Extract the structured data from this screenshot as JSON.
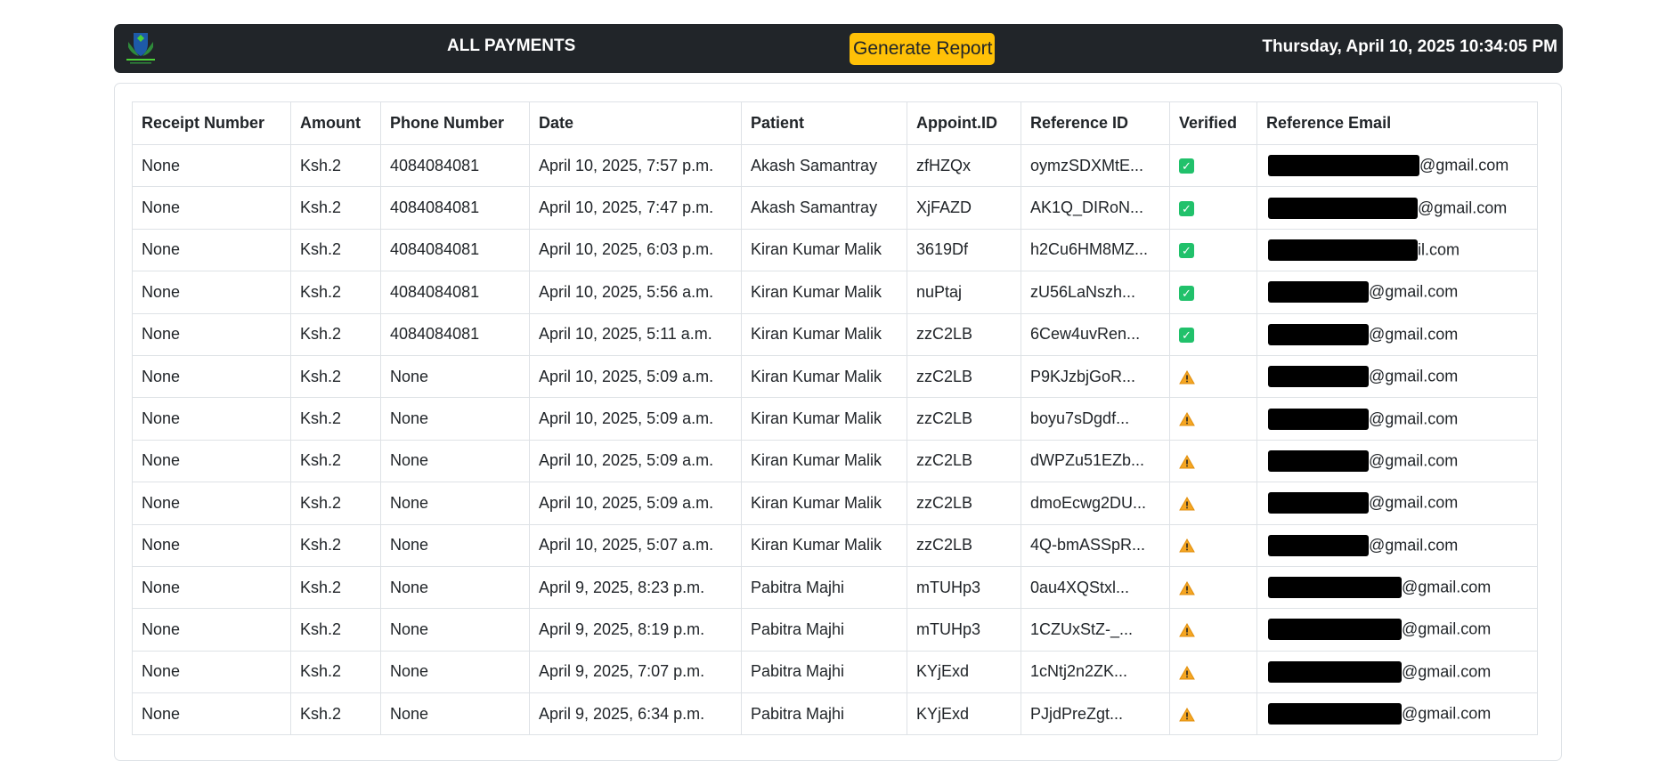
{
  "nav": {
    "title": "ALL PAYMENTS",
    "generate_label": "Generate Report",
    "datetime": "Thursday, April 10, 2025 10:34:05 PM",
    "logo_icon": "shield-leaf-logo-icon",
    "accent_color": "#ffc107",
    "bar_color": "#212529"
  },
  "table": {
    "headers": {
      "receipt": "Receipt Number",
      "amount": "Amount",
      "phone": "Phone Number",
      "date": "Date",
      "patient": "Patient",
      "appoint": "Appoint.ID",
      "reference": "Reference ID",
      "verified": "Verified",
      "email": "Reference Email"
    },
    "rows": [
      {
        "receipt": "None",
        "amount": "Ksh.2",
        "phone": "4084084081",
        "date": "April 10, 2025, 7:57 p.m.",
        "patient": "Akash Samantray",
        "appoint": "zfHZQx",
        "reference": "oymzSDXMtE...",
        "verified": "check",
        "email_suffix": "@gmail.com"
      },
      {
        "receipt": "None",
        "amount": "Ksh.2",
        "phone": "4084084081",
        "date": "April 10, 2025, 7:47 p.m.",
        "patient": "Akash Samantray",
        "appoint": "XjFAZD",
        "reference": "AK1Q_DIRoN...",
        "verified": "check",
        "email_suffix": "@gmail.com"
      },
      {
        "receipt": "None",
        "amount": "Ksh.2",
        "phone": "4084084081",
        "date": "April 10, 2025, 6:03 p.m.",
        "patient": "Kiran Kumar Malik",
        "appoint": "3619Df",
        "reference": "h2Cu6HM8MZ...",
        "verified": "check",
        "email_suffix": "il.com"
      },
      {
        "receipt": "None",
        "amount": "Ksh.2",
        "phone": "4084084081",
        "date": "April 10, 2025, 5:56 a.m.",
        "patient": "Kiran Kumar Malik",
        "appoint": "nuPtaj",
        "reference": "zU56LaNszh...",
        "verified": "check",
        "email_suffix": "@gmail.com"
      },
      {
        "receipt": "None",
        "amount": "Ksh.2",
        "phone": "4084084081",
        "date": "April 10, 2025, 5:11 a.m.",
        "patient": "Kiran Kumar Malik",
        "appoint": "zzC2LB",
        "reference": "6Cew4uvRen...",
        "verified": "check",
        "email_suffix": "@gmail.com"
      },
      {
        "receipt": "None",
        "amount": "Ksh.2",
        "phone": "None",
        "date": "April 10, 2025, 5:09 a.m.",
        "patient": "Kiran Kumar Malik",
        "appoint": "zzC2LB",
        "reference": "P9KJzbjGoR...",
        "verified": "warning",
        "email_suffix": "@gmail.com"
      },
      {
        "receipt": "None",
        "amount": "Ksh.2",
        "phone": "None",
        "date": "April 10, 2025, 5:09 a.m.",
        "patient": "Kiran Kumar Malik",
        "appoint": "zzC2LB",
        "reference": "boyu7sDgdf...",
        "verified": "warning",
        "email_suffix": "@gmail.com"
      },
      {
        "receipt": "None",
        "amount": "Ksh.2",
        "phone": "None",
        "date": "April 10, 2025, 5:09 a.m.",
        "patient": "Kiran Kumar Malik",
        "appoint": "zzC2LB",
        "reference": "dWPZu51EZb...",
        "verified": "warning",
        "email_suffix": "@gmail.com"
      },
      {
        "receipt": "None",
        "amount": "Ksh.2",
        "phone": "None",
        "date": "April 10, 2025, 5:09 a.m.",
        "patient": "Kiran Kumar Malik",
        "appoint": "zzC2LB",
        "reference": "dmoEcwg2DU...",
        "verified": "warning",
        "email_suffix": "@gmail.com"
      },
      {
        "receipt": "None",
        "amount": "Ksh.2",
        "phone": "None",
        "date": "April 10, 2025, 5:07 a.m.",
        "patient": "Kiran Kumar Malik",
        "appoint": "zzC2LB",
        "reference": "4Q-bmASSpR...",
        "verified": "warning",
        "email_suffix": "@gmail.com"
      },
      {
        "receipt": "None",
        "amount": "Ksh.2",
        "phone": "None",
        "date": "April 9, 2025, 8:23 p.m.",
        "patient": "Pabitra Majhi",
        "appoint": "mTUHp3",
        "reference": "0au4XQStxl...",
        "verified": "warning",
        "email_suffix": "@gmail.com"
      },
      {
        "receipt": "None",
        "amount": "Ksh.2",
        "phone": "None",
        "date": "April 9, 2025, 8:19 p.m.",
        "patient": "Pabitra Majhi",
        "appoint": "mTUHp3",
        "reference": "1CZUxStZ-_...",
        "verified": "warning",
        "email_suffix": "@gmail.com"
      },
      {
        "receipt": "None",
        "amount": "Ksh.2",
        "phone": "None",
        "date": "April 9, 2025, 7:07 p.m.",
        "patient": "Pabitra Majhi",
        "appoint": "KYjExd",
        "reference": "1cNtj2n2ZK...",
        "verified": "warning",
        "email_suffix": "@gmail.com"
      },
      {
        "receipt": "None",
        "amount": "Ksh.2",
        "phone": "None",
        "date": "April 9, 2025, 6:34 p.m.",
        "patient": "Pabitra Majhi",
        "appoint": "KYjExd",
        "reference": "PJjdPreZgt...",
        "verified": "warning",
        "email_suffix": "@gmail.com"
      }
    ]
  }
}
